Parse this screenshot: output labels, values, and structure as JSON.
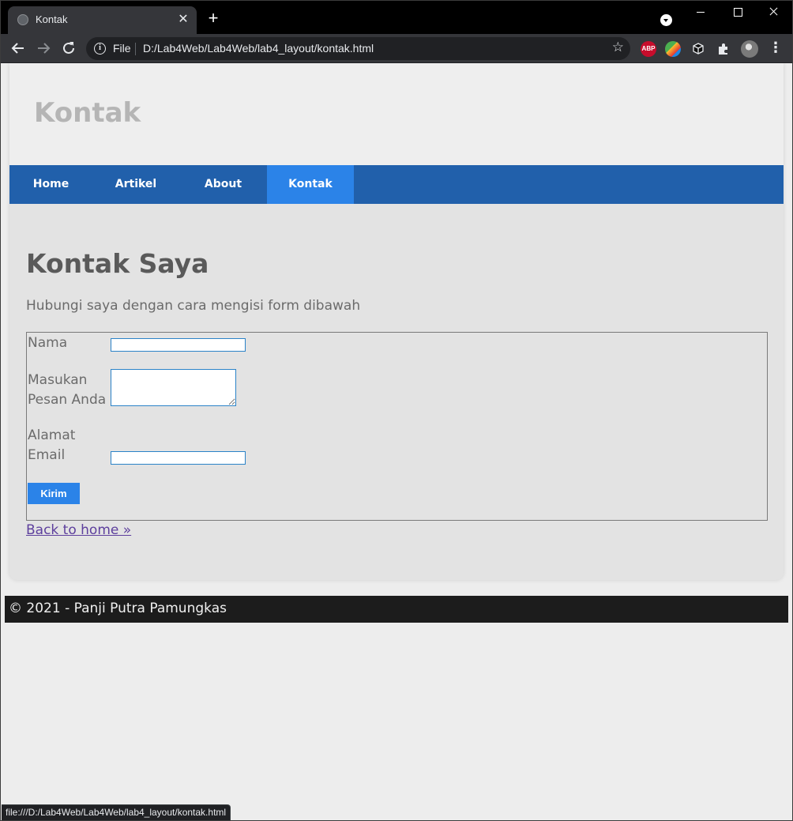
{
  "browser": {
    "tab_title": "Kontak",
    "tab_close_glyph": "✕",
    "new_tab_glyph": "+",
    "url_scheme": "File",
    "url": "D:/Lab4Web/Lab4Web/lab4_layout/kontak.html",
    "status_url": "file:///D:/Lab4Web/Lab4Web/lab4_layout/kontak.html",
    "extensions": [
      "adblock-plus-icon",
      "color-picker-icon",
      "cube-extension-icon",
      "puzzle-extensions-icon"
    ],
    "abp_label": "ABP"
  },
  "site": {
    "title": "Kontak",
    "nav": [
      {
        "label": "Home",
        "active": false
      },
      {
        "label": "Artikel",
        "active": false
      },
      {
        "label": "About",
        "active": false
      },
      {
        "label": "Kontak",
        "active": true
      }
    ]
  },
  "content": {
    "heading": "Kontak Saya",
    "lead": "Hubungi saya dengan cara mengisi form dibawah",
    "form": {
      "name_label": "Nama",
      "name_value": "",
      "message_label": "Masukan Pesan Anda",
      "message_value": "",
      "email_label": "Alamat Email",
      "email_value": "",
      "submit_label": "Kirim"
    },
    "back_link": "Back to home »"
  },
  "footer": {
    "text": "© 2021 - Panji Putra Pamungkas"
  },
  "colors": {
    "nav_bg": "#2160ab",
    "nav_active": "#2b83e8",
    "footer_bg": "#1c1c1c",
    "link": "#5d3f9d"
  }
}
